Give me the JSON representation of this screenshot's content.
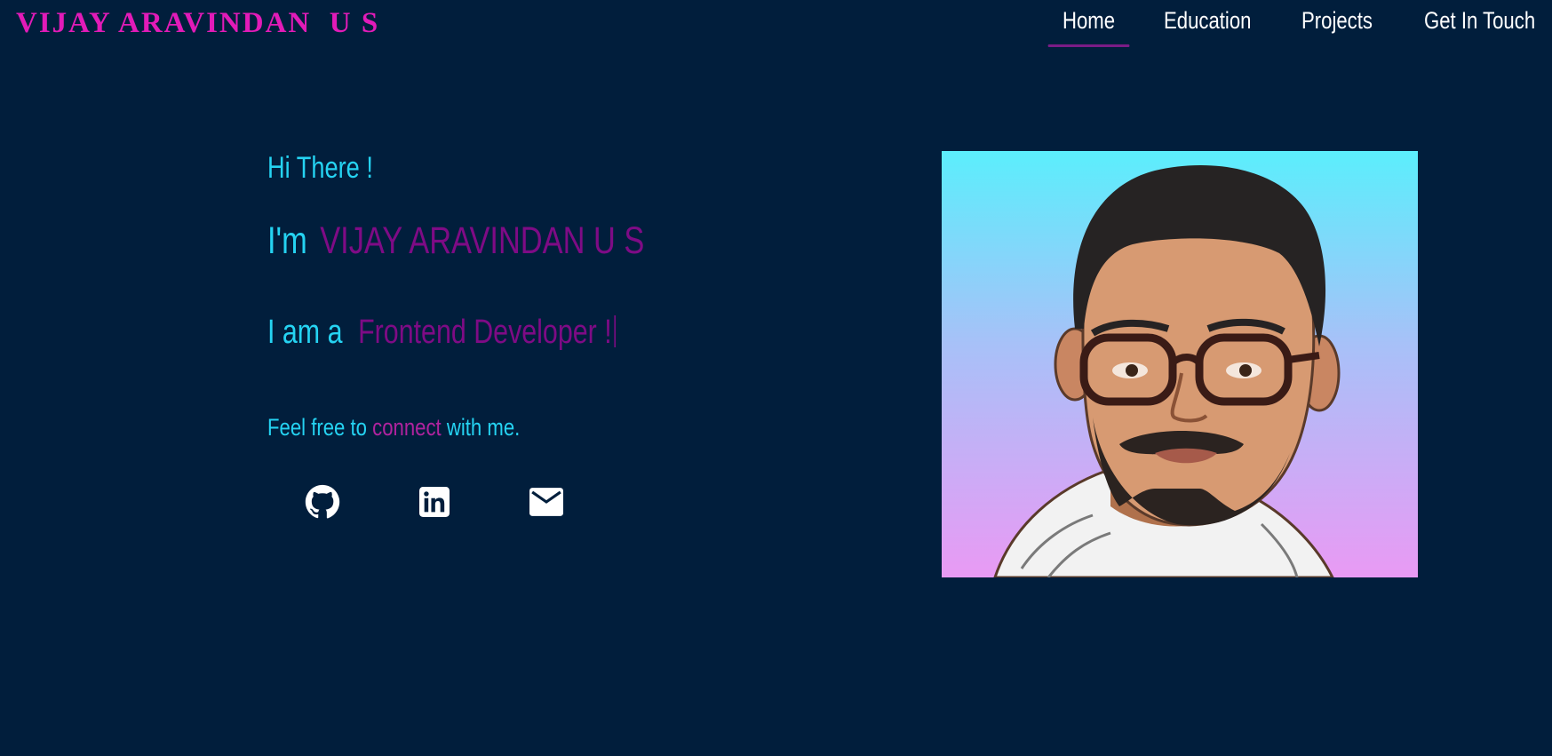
{
  "brand": {
    "name": "VIJAY ARAVINDAN  U S"
  },
  "nav": {
    "items": [
      {
        "label": "Home",
        "active": true
      },
      {
        "label": "Education",
        "active": false
      },
      {
        "label": "Projects",
        "active": false
      },
      {
        "label": "Get In Touch",
        "active": false
      }
    ]
  },
  "hero": {
    "greeting": "Hi There !",
    "intro_prefix": "I'm",
    "name": "VIJAY ARAVINDAN U S",
    "role_prefix": "I am a",
    "role": "Frontend Developer !",
    "connect_before": "Feel free to ",
    "connect_highlight": "connect",
    "connect_after": " with me."
  },
  "socials": [
    {
      "icon": "github-icon"
    },
    {
      "icon": "linkedin-icon"
    },
    {
      "icon": "mail-icon"
    }
  ],
  "colors": {
    "background": "#011e3c",
    "brand": "#e21bb8",
    "accent_cyan": "#25d3f2",
    "accent_purple": "#7e0b85",
    "nav_underline": "#7b1c86"
  }
}
